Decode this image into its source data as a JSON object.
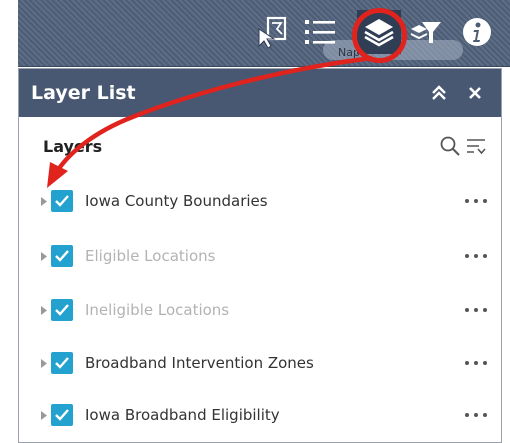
{
  "toolbar": {
    "tools": [
      {
        "icon": "select-cursor-icon"
      },
      {
        "icon": "legend-list-icon"
      },
      {
        "icon": "layers-stack-icon",
        "active": true
      },
      {
        "icon": "filter-icon"
      },
      {
        "icon": "info-icon"
      }
    ],
    "map_label": "Napo",
    "highlight_color": "#e0231c"
  },
  "panel": {
    "title": "Layer List",
    "collapse_icon": "double-chevron-up-icon",
    "close_icon": "close-icon",
    "header_color": "#485872"
  },
  "layers": {
    "heading": "Layers",
    "search_icon": "search-icon",
    "sort_icon": "filter-list-icon",
    "check_color": "#23a2cf",
    "items": [
      {
        "label": "Iowa County Boundaries",
        "checked": true,
        "dimmed": false
      },
      {
        "label": "Eligible Locations",
        "checked": true,
        "dimmed": true
      },
      {
        "label": "Ineligible Locations",
        "checked": true,
        "dimmed": true
      },
      {
        "label": "Broadband Intervention Zones",
        "checked": true,
        "dimmed": false
      },
      {
        "label": "Iowa Broadband Eligibility",
        "checked": true,
        "dimmed": false
      }
    ]
  }
}
